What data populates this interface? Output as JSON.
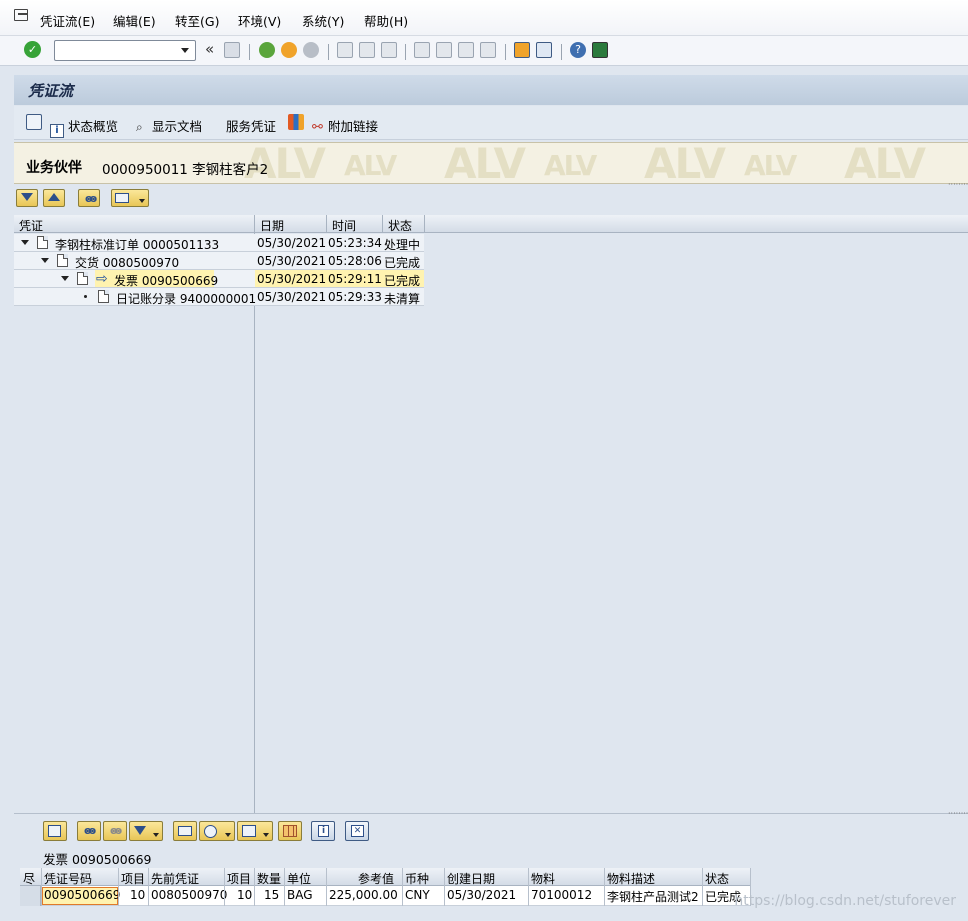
{
  "menu": {
    "items": [
      "凭证流(E)",
      "编辑(E)",
      "转至(G)",
      "环境(V)",
      "系统(Y)",
      "帮助(H)"
    ]
  },
  "toolbar": {
    "command_field_value": "",
    "back_chevrons": "«"
  },
  "title": "凭证流",
  "app_toolbar": {
    "status_overview": "状态概览",
    "display_document": "显示文档",
    "service_document": "服务凭证",
    "attach_link": "附加链接"
  },
  "header": {
    "partner_label": "业务伙伴",
    "partner_value": "0000950011 李钢柱客户2",
    "watermark_text": "ALV"
  },
  "tree": {
    "columns": [
      "凭证",
      "日期",
      "时间",
      "状态"
    ],
    "rows": [
      {
        "label": "李钢柱标准订单 0000501133",
        "date": "05/30/2021",
        "time": "05:23:34",
        "status": "处理中"
      },
      {
        "label": "交货 0080500970",
        "date": "05/30/2021",
        "time": "05:28:06",
        "status": "已完成"
      },
      {
        "label": "发票 0090500669",
        "date": "05/30/2021",
        "time": "05:29:11",
        "status": "已完成"
      },
      {
        "label": "日记账分录 9400000001",
        "date": "05/30/2021",
        "time": "05:29:33",
        "status": "未清算"
      }
    ]
  },
  "bottom": {
    "title": "发票 0090500669",
    "headers": {
      "selector": "尽",
      "doc_no": "凭证号码",
      "item": "项目",
      "prev_doc": "先前凭证",
      "item2": "项目",
      "qty": "数量",
      "unit": "单位",
      "ref_value": "参考值",
      "currency": "币种",
      "created": "创建日期",
      "material": "物料",
      "material_desc": "物料描述",
      "status": "状态"
    },
    "row": {
      "doc_no": "0090500669",
      "item": "10",
      "prev_doc": "0080500970",
      "item2": "10",
      "qty": "15",
      "unit": "BAG",
      "ref_value": "225,000.00",
      "currency": "CNY",
      "created": "05/30/2021",
      "material": "70100012",
      "material_desc": "李钢柱产品测试2",
      "status": "已完成"
    }
  },
  "watermark": "https://blog.csdn.net/stuforever",
  "colors": {
    "highlight": "#fff3b0",
    "header_band": "#f4f1e3",
    "enter_green": "#37a338"
  }
}
